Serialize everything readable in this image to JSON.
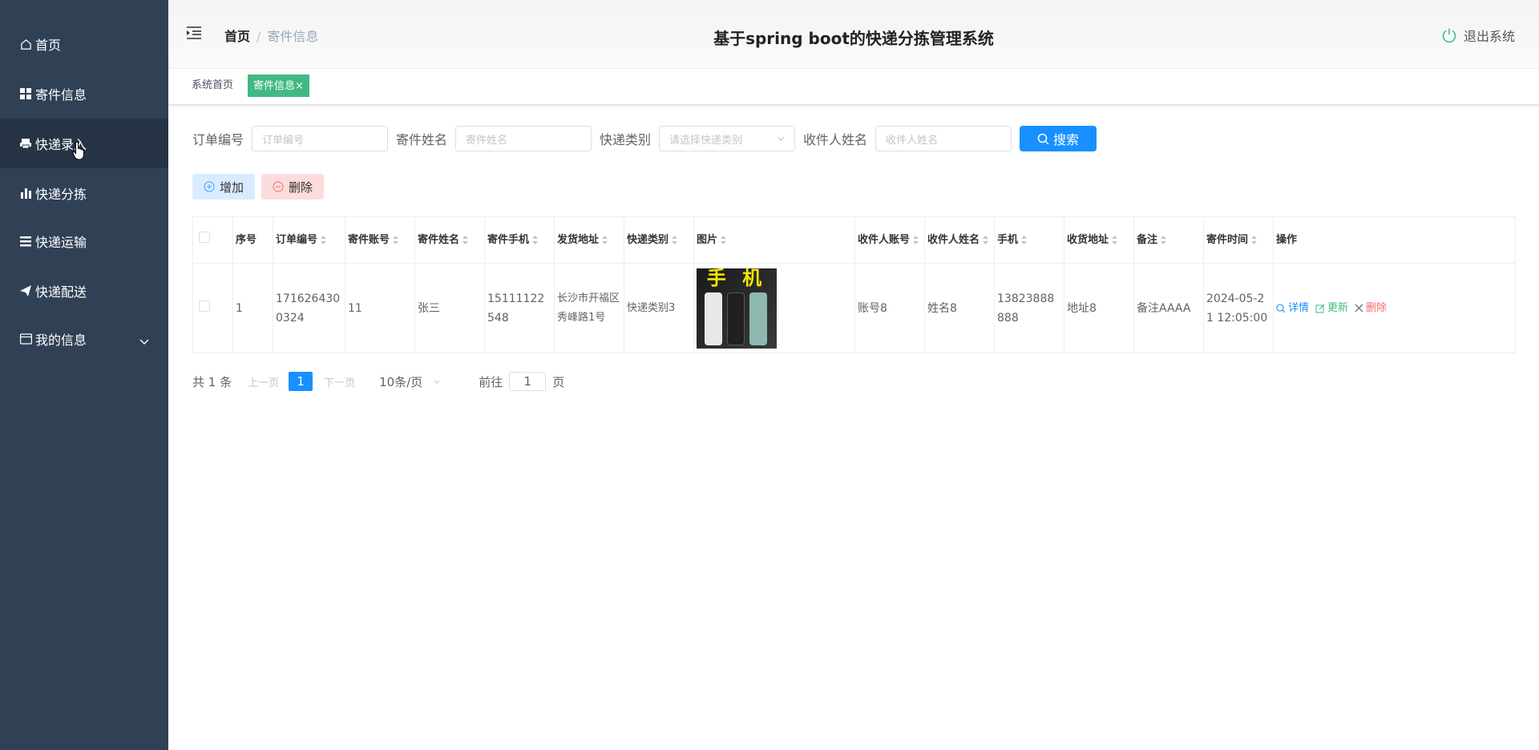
{
  "sidebar": {
    "items": [
      {
        "label": "首页",
        "icon": "home-icon"
      },
      {
        "label": "寄件信息",
        "icon": "grid-icon"
      },
      {
        "label": "快递录入",
        "icon": "printer-icon"
      },
      {
        "label": "快递分拣",
        "icon": "bar-chart-icon"
      },
      {
        "label": "快递运输",
        "icon": "list-icon"
      },
      {
        "label": "快递配送",
        "icon": "send-icon"
      },
      {
        "label": "我的信息",
        "icon": "profile-icon"
      }
    ],
    "colors": {
      "bg": "#304156",
      "hover": "#263445"
    }
  },
  "header": {
    "breadcrumb_home": "首页",
    "breadcrumb_sep": "/",
    "breadcrumb_current": "寄件信息",
    "title": "基于spring boot的快递分拣管理系统",
    "logout": "退出系统"
  },
  "tags": {
    "home": "系统首页",
    "active": "寄件信息",
    "close": "×",
    "active_color": "#42b983"
  },
  "search": {
    "order_label": "订单编号",
    "order_placeholder": "订单编号",
    "sender_label": "寄件姓名",
    "sender_placeholder": "寄件姓名",
    "type_label": "快递类别",
    "type_placeholder": "请选择快递类别",
    "receiver_label": "收件人姓名",
    "receiver_placeholder": "收件人姓名",
    "button": "搜索",
    "button_color": "#1890ff"
  },
  "actions": {
    "add": "增加",
    "delete": "删除"
  },
  "table": {
    "headers": [
      "序号",
      "订单编号",
      "寄件账号",
      "寄件姓名",
      "寄件手机",
      "发货地址",
      "快递类别",
      "图片",
      "收件人账号",
      "收件人姓名",
      "手机",
      "收货地址",
      "备注",
      "寄件时间",
      "操作"
    ],
    "rows": [
      {
        "index": "1",
        "order_no": "1716264300324",
        "account": "11",
        "name": "张三",
        "phone": "15111122548",
        "address": "长沙市开福区秀峰路1号",
        "type": "快递类别3",
        "image_text": "手 机",
        "receiver_account": "账号8",
        "receiver_name": "姓名8",
        "receiver_phone": "13823888888",
        "receiver_address": "地址8",
        "remark": "备注AAAA",
        "time": "2024-05-21 12:05:00",
        "op_detail": "详情",
        "op_update": "更新",
        "op_delete": "删除"
      }
    ]
  },
  "pager": {
    "total": "共 1 条",
    "prev": "上一页",
    "current": "1",
    "next": "下一页",
    "size": "10条/页",
    "goto": "前往",
    "goto_value": "1",
    "page_unit": "页"
  }
}
